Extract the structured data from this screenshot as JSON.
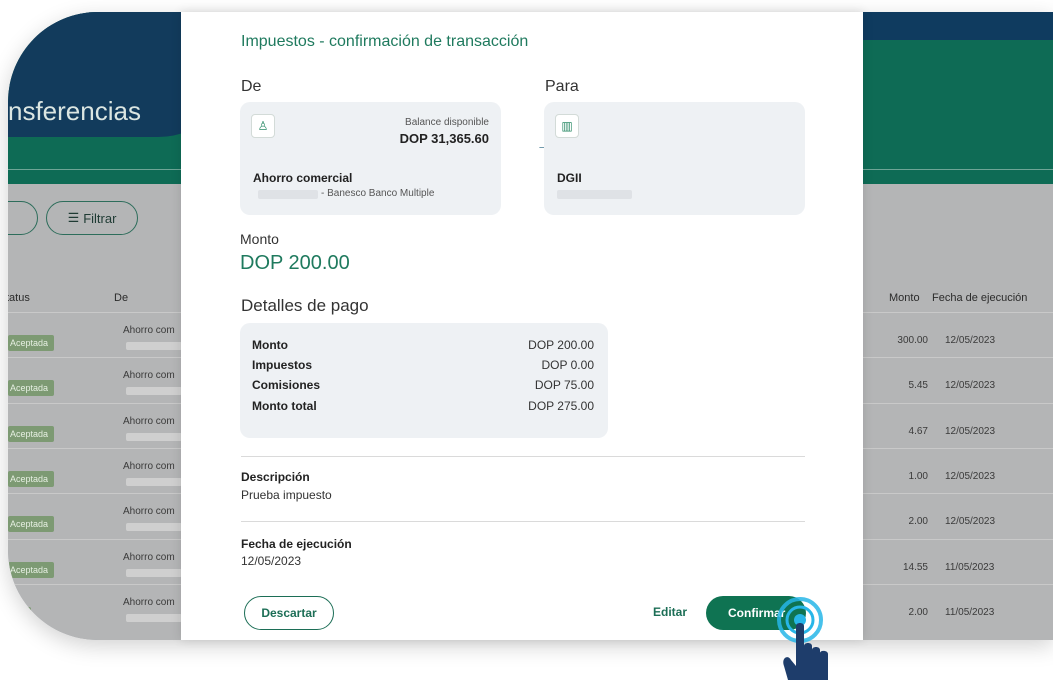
{
  "background": {
    "page_title": "nsferencias",
    "filter_label": "Filtrar",
    "columns": {
      "status": "tatus",
      "de": "De",
      "monto": "Monto",
      "fecha": "Fecha de ejecución"
    },
    "rows": [
      {
        "status": "Aceptada",
        "de": "Ahorro com",
        "monto": "300.00",
        "fecha": "12/05/2023"
      },
      {
        "status": "Aceptada",
        "de": "Ahorro com",
        "monto": "5.45",
        "fecha": "12/05/2023"
      },
      {
        "status": "Aceptada",
        "de": "Ahorro com",
        "monto": "4.67",
        "fecha": "12/05/2023"
      },
      {
        "status": "Aceptada",
        "de": "Ahorro com",
        "monto": "1.00",
        "fecha": "12/05/2023"
      },
      {
        "status": "Aceptada",
        "de": "Ahorro com",
        "monto": "2.00",
        "fecha": "12/05/2023"
      },
      {
        "status": "Aceptada",
        "de": "Ahorro com",
        "monto": "14.55",
        "fecha": "11/05/2023"
      },
      {
        "status": "ada",
        "de": "Ahorro com",
        "monto": "2.00",
        "fecha": "11/05/2023"
      }
    ]
  },
  "modal": {
    "title": "Impuestos - confirmación de transacción",
    "from_label": "De",
    "to_label": "Para",
    "from_account": {
      "balance_label": "Balance disponible",
      "balance": "DOP 31,365.60",
      "name": "Ahorro comercial",
      "bank": "- Banesco Banco Multiple"
    },
    "to_account": {
      "name": "DGII"
    },
    "amount_label": "Monto",
    "amount": "DOP 200.00",
    "details_title": "Detalles de pago",
    "details": [
      {
        "label": "Monto",
        "value": "DOP 200.00"
      },
      {
        "label": "Impuestos",
        "value": "DOP 0.00"
      },
      {
        "label": "Comisiones",
        "value": "DOP 75.00"
      },
      {
        "label": "Monto total",
        "value": "DOP 275.00"
      }
    ],
    "description_label": "Descripción",
    "description": "Prueba impuesto",
    "date_label": "Fecha de ejecución",
    "date": "12/05/2023",
    "discard_label": "Descartar",
    "edit_label": "Editar",
    "confirm_label": "Confirmar"
  },
  "colors": {
    "brand_green": "#0f7352",
    "header_navy": "#0f3b5f",
    "accent_text": "#1f7a5e",
    "tap_ring": "#27b6e8"
  }
}
